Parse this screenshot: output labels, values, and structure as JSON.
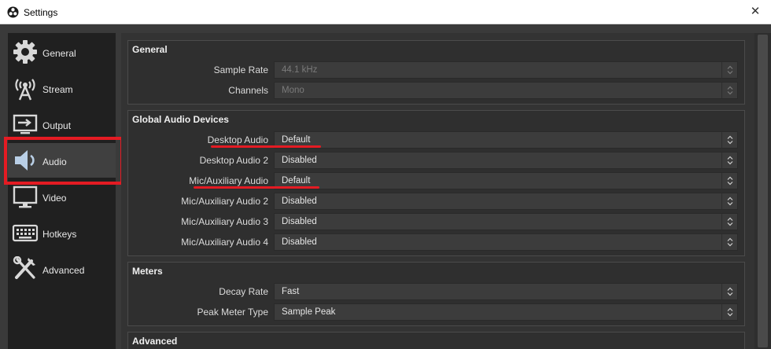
{
  "window": {
    "title": "Settings"
  },
  "sidebar": {
    "items": [
      {
        "label": "General",
        "icon": "gear-icon"
      },
      {
        "label": "Stream",
        "icon": "broadcast-icon"
      },
      {
        "label": "Output",
        "icon": "output-icon"
      },
      {
        "label": "Audio",
        "icon": "speaker-icon"
      },
      {
        "label": "Video",
        "icon": "monitor-icon"
      },
      {
        "label": "Hotkeys",
        "icon": "keyboard-icon"
      },
      {
        "label": "Advanced",
        "icon": "tools-icon"
      }
    ],
    "active": "Audio"
  },
  "sections": {
    "general": {
      "title": "General",
      "sample_rate": {
        "label": "Sample Rate",
        "value": "44.1 kHz"
      },
      "channels": {
        "label": "Channels",
        "value": "Mono"
      }
    },
    "global_devices": {
      "title": "Global Audio Devices",
      "desktop_audio": {
        "label": "Desktop Audio",
        "value": "Default"
      },
      "desktop_audio_2": {
        "label": "Desktop Audio 2",
        "value": "Disabled"
      },
      "mic_aux": {
        "label": "Mic/Auxiliary Audio",
        "value": "Default"
      },
      "mic_aux_2": {
        "label": "Mic/Auxiliary Audio 2",
        "value": "Disabled"
      },
      "mic_aux_3": {
        "label": "Mic/Auxiliary Audio 3",
        "value": "Disabled"
      },
      "mic_aux_4": {
        "label": "Mic/Auxiliary Audio 4",
        "value": "Disabled"
      }
    },
    "meters": {
      "title": "Meters",
      "decay_rate": {
        "label": "Decay Rate",
        "value": "Fast"
      },
      "peak_meter_type": {
        "label": "Peak Meter Type",
        "value": "Sample Peak"
      }
    },
    "advanced": {
      "title": "Advanced"
    }
  },
  "colors": {
    "highlight": "#e41b23",
    "sidebar_bg": "#202020",
    "panel_bg": "#2f2f2f"
  }
}
